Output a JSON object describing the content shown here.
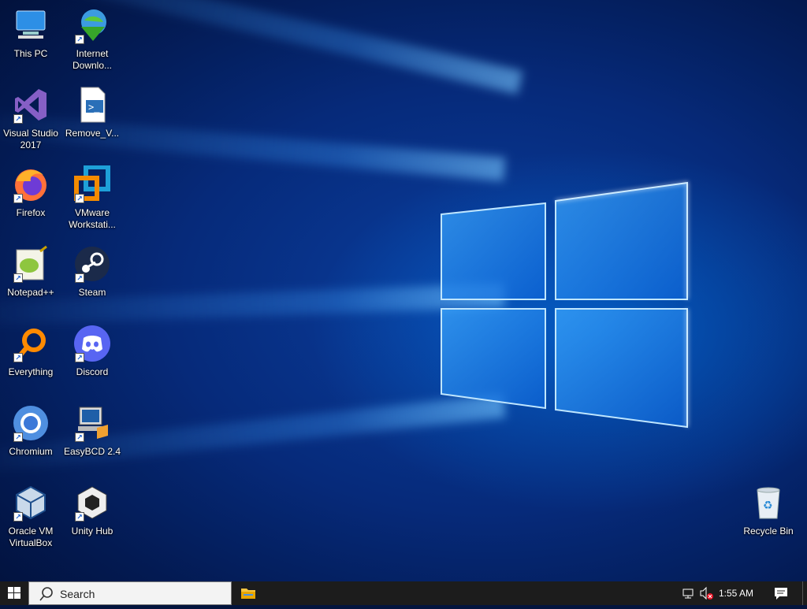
{
  "desktop": {
    "icons": [
      {
        "id": "this-pc",
        "label": "This PC"
      },
      {
        "id": "internet-download-manager",
        "label": "Internet Downlo..."
      },
      {
        "id": "visual-studio-2017",
        "label": "Visual Studio 2017"
      },
      {
        "id": "remove-v",
        "label": "Remove_V..."
      },
      {
        "id": "firefox",
        "label": "Firefox"
      },
      {
        "id": "vmware-workstation",
        "label": "VMware Workstati..."
      },
      {
        "id": "notepad-plus-plus",
        "label": "Notepad++"
      },
      {
        "id": "steam",
        "label": "Steam"
      },
      {
        "id": "everything",
        "label": "Everything"
      },
      {
        "id": "discord",
        "label": "Discord"
      },
      {
        "id": "chromium",
        "label": "Chromium"
      },
      {
        "id": "easybcd",
        "label": "EasyBCD 2.4"
      },
      {
        "id": "oracle-vm-virtualbox",
        "label": "Oracle VM VirtualBox"
      },
      {
        "id": "unity-hub",
        "label": "Unity Hub"
      },
      {
        "id": "recycle-bin",
        "label": "Recycle Bin"
      }
    ]
  },
  "taskbar": {
    "start_icon": "windows-logo-icon",
    "search_placeholder": "Search",
    "pinned": [
      {
        "name": "File Explorer",
        "icon": "folder-icon"
      }
    ],
    "tray": {
      "network_icon": "network-icon",
      "volume_icon": "volume-muted-icon",
      "time": "1:55 AM",
      "notification_icon": "action-center-icon"
    }
  },
  "colors": {
    "taskbar_bg": "#1c1c1c",
    "wallpaper_glow": "#2f9cff",
    "wallpaper_dark": "#031a52"
  }
}
